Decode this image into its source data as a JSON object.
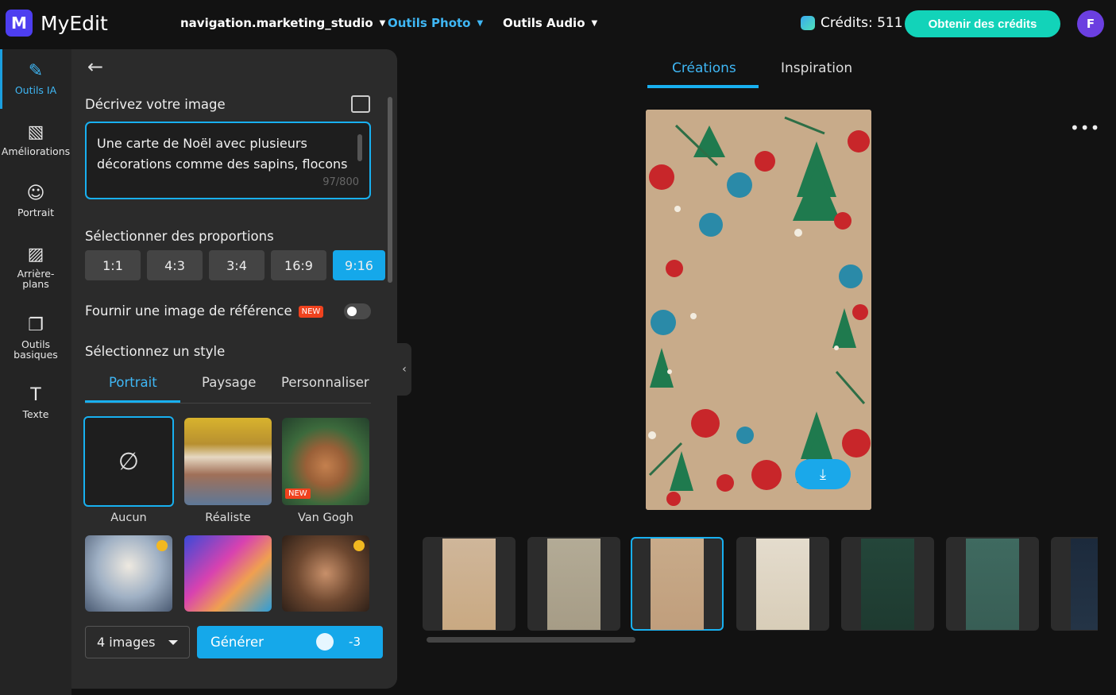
{
  "app": {
    "name": "MyEdit",
    "logo_letter": "M"
  },
  "topnav": {
    "items": [
      {
        "label": "navigation.marketing_studio",
        "active": false
      },
      {
        "label": "Outils Photo",
        "active": true
      },
      {
        "label": "Outils Audio",
        "active": false
      }
    ],
    "credits_label": "Crédits: 511",
    "get_credits_label": "Obtenir des crédits",
    "avatar_initial": "F"
  },
  "sidebar": {
    "items": [
      {
        "label": "Outils IA",
        "icon": "magic-wand-icon",
        "active": true
      },
      {
        "label": "Améliorations",
        "icon": "image-enhance-icon",
        "active": false
      },
      {
        "label": "Portrait",
        "icon": "portrait-icon",
        "active": false
      },
      {
        "label": "Arrière-plans",
        "icon": "background-icon",
        "active": false
      },
      {
        "label": "Outils basiques",
        "icon": "basic-tools-icon",
        "active": false
      },
      {
        "label": "Texte",
        "icon": "text-icon",
        "active": false
      }
    ]
  },
  "panel": {
    "describe_label": "Décrivez votre image",
    "prompt_text": "Une carte de Noël avec plusieurs décorations comme des sapins, flocons",
    "prompt_count": "97/800",
    "proportions_label": "Sélectionner des proportions",
    "ratios": [
      "1:1",
      "4:3",
      "3:4",
      "16:9",
      "9:16"
    ],
    "selected_ratio": "9:16",
    "reference_label": "Fournir une image de référence",
    "new_badge": "NEW",
    "style_label": "Sélectionnez un style",
    "style_tabs": [
      "Portrait",
      "Paysage",
      "Personnaliser"
    ],
    "active_style_tab": "Portrait",
    "styles": [
      {
        "label": "Aucun",
        "selected": true
      },
      {
        "label": "Réaliste",
        "selected": false
      },
      {
        "label": "Van Gogh",
        "selected": false,
        "badge": "NEW"
      }
    ],
    "image_count": "4 images",
    "generate_label": "Générer",
    "generate_cost": "-3"
  },
  "main": {
    "tabs": [
      "Créations",
      "Inspiration"
    ],
    "active_tab": "Créations",
    "more_label": "•••"
  },
  "colors": {
    "accent": "#18b0f0",
    "credits_button": "#12d3b9",
    "new_badge": "#f0421e"
  }
}
